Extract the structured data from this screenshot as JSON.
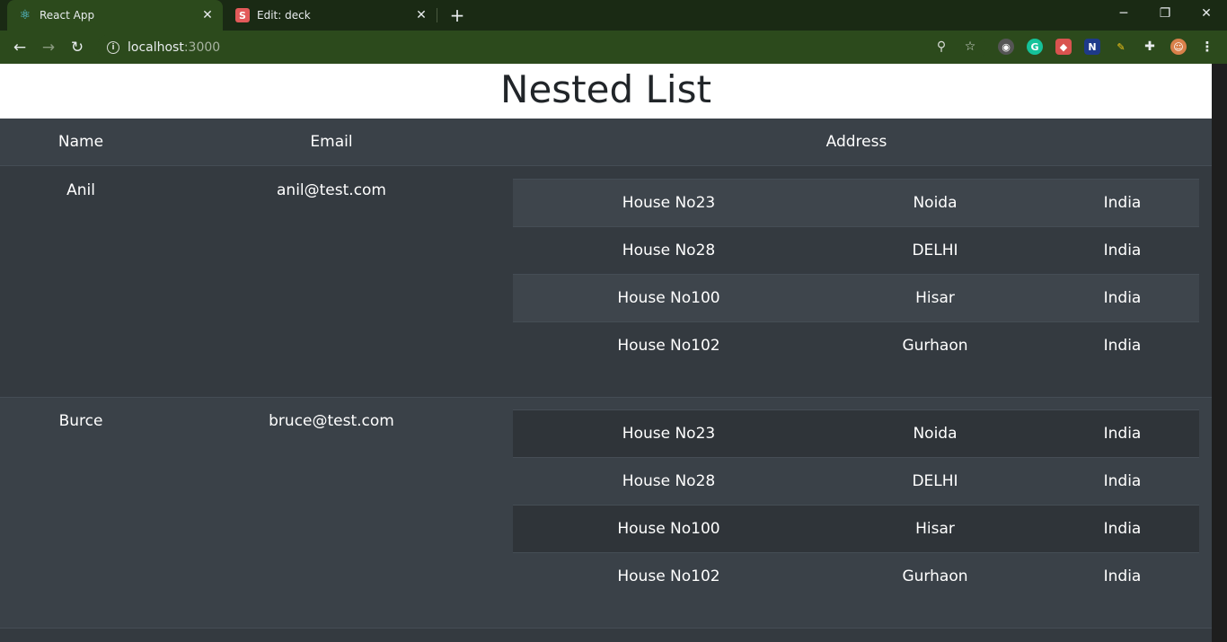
{
  "browser": {
    "tabs": [
      {
        "title": "React App",
        "favicon": "react-icon"
      },
      {
        "title": "Edit: deck",
        "favicon": "S"
      }
    ],
    "url_host": "localhost",
    "url_port": ":3000"
  },
  "page": {
    "title": "Nested List",
    "headers": {
      "name": "Name",
      "email": "Email",
      "address": "Address"
    },
    "users": [
      {
        "name": "Anil",
        "email": "anil@test.com",
        "address": [
          {
            "house": "House No23",
            "city": "Noida",
            "country": "India"
          },
          {
            "house": "House No28",
            "city": "DELHI",
            "country": "India"
          },
          {
            "house": "House No100",
            "city": "Hisar",
            "country": "India"
          },
          {
            "house": "House No102",
            "city": "Gurhaon",
            "country": "India"
          }
        ]
      },
      {
        "name": "Burce",
        "email": "bruce@test.com",
        "address": [
          {
            "house": "House No23",
            "city": "Noida",
            "country": "India"
          },
          {
            "house": "House No28",
            "city": "DELHI",
            "country": "India"
          },
          {
            "house": "House No100",
            "city": "Hisar",
            "country": "India"
          },
          {
            "house": "House No102",
            "city": "Gurhaon",
            "country": "India"
          }
        ]
      }
    ]
  },
  "colors": {
    "row_odd": "#3a4148",
    "row_even": "#343a40",
    "inner_striped": "#3e454c",
    "inner_dark": "#2f3439"
  }
}
